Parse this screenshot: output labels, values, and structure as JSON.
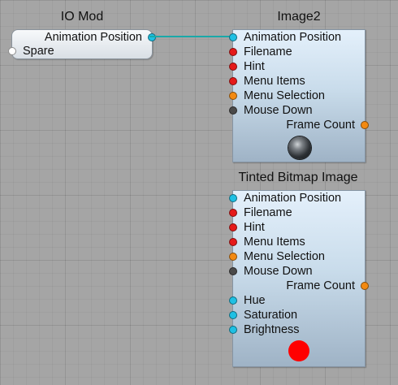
{
  "io_mod": {
    "title": "IO Mod",
    "ports": {
      "animation_position": {
        "label": "Animation Position",
        "color": "#1ec0e4"
      },
      "spare": {
        "label": "Spare",
        "color": "#ffffff"
      }
    }
  },
  "image2": {
    "title": "Image2",
    "inputs": [
      {
        "label": "Animation Position",
        "color": "#1ec0e4"
      },
      {
        "label": "Filename",
        "color": "#e51a1a"
      },
      {
        "label": "Hint",
        "color": "#e51a1a"
      },
      {
        "label": "Menu Items",
        "color": "#e51a1a"
      },
      {
        "label": "Menu Selection",
        "color": "#f38a12"
      },
      {
        "label": "Mouse Down",
        "color": "#4a4a4a"
      }
    ],
    "outputs": [
      {
        "label": "Frame Count",
        "color": "#f38a12"
      }
    ],
    "preview": "grey-sphere"
  },
  "tinted_bitmap": {
    "title": "Tinted Bitmap Image",
    "inputs": [
      {
        "label": "Animation Position",
        "color": "#1ec0e4"
      },
      {
        "label": "Filename",
        "color": "#e51a1a"
      },
      {
        "label": "Hint",
        "color": "#e51a1a"
      },
      {
        "label": "Menu Items",
        "color": "#e51a1a"
      },
      {
        "label": "Menu Selection",
        "color": "#f38a12"
      },
      {
        "label": "Mouse Down",
        "color": "#4a4a4a"
      }
    ],
    "outputs": [
      {
        "label": "Frame Count",
        "color": "#f38a12"
      }
    ],
    "inputs_extra": [
      {
        "label": "Hue",
        "color": "#1ec0e4"
      },
      {
        "label": "Saturation",
        "color": "#1ec0e4"
      },
      {
        "label": "Brightness",
        "color": "#1ec0e4"
      }
    ],
    "preview": "red-dot"
  },
  "connection": {
    "color": "#1aa9a9",
    "from": "IO Mod.Animation Position",
    "to": "Image2.Animation Position"
  }
}
